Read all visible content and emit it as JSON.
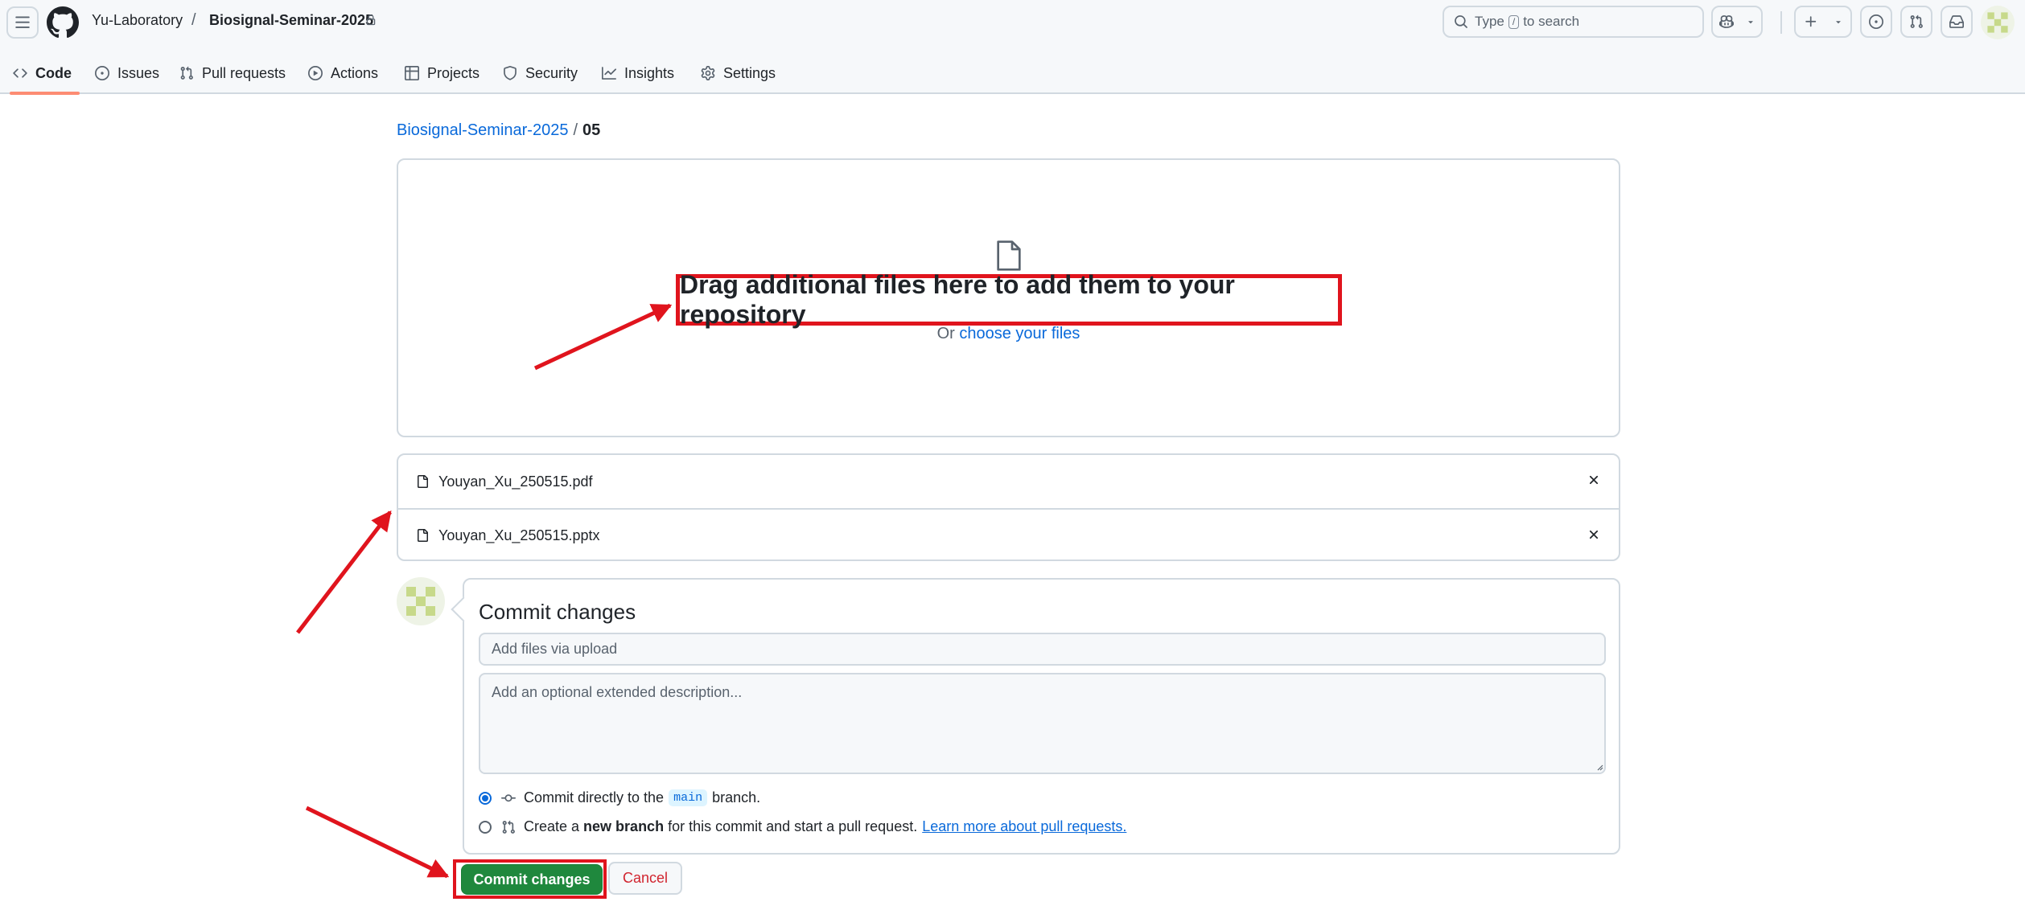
{
  "header": {
    "owner": "Yu-Laboratory",
    "separator": "/",
    "repo": "Biosignal-Seminar-2025",
    "search": {
      "prefix": "Type",
      "key": "/",
      "suffix": "to search"
    }
  },
  "tabs": [
    {
      "label": "Code",
      "icon": "code-icon",
      "active": true
    },
    {
      "label": "Issues",
      "icon": "issue-opened-icon"
    },
    {
      "label": "Pull requests",
      "icon": "git-pull-request-icon"
    },
    {
      "label": "Actions",
      "icon": "play-icon"
    },
    {
      "label": "Projects",
      "icon": "table-icon"
    },
    {
      "label": "Security",
      "icon": "shield-icon"
    },
    {
      "label": "Insights",
      "icon": "graph-icon"
    },
    {
      "label": "Settings",
      "icon": "gear-icon"
    }
  ],
  "breadcrumb": {
    "repo": "Biosignal-Seminar-2025",
    "separator": "/",
    "folder": "05"
  },
  "dropzone": {
    "title": "Drag additional files here to add them to your repository",
    "or": "Or",
    "choose": "choose your files"
  },
  "files": [
    {
      "name": "Youyan_Xu_250515.pdf"
    },
    {
      "name": "Youyan_Xu_250515.pptx"
    }
  ],
  "commit": {
    "title": "Commit changes",
    "message_placeholder": "Add files via upload",
    "description_placeholder": "Add an optional extended description...",
    "option_direct": {
      "before": "Commit directly to the",
      "branch": "main",
      "after": "branch.",
      "selected": true
    },
    "option_new": {
      "before": "Create a",
      "bold": "new branch",
      "after": "for this commit and start a pull request.",
      "link": "Learn more about pull requests."
    }
  },
  "buttons": {
    "commit": "Commit changes",
    "cancel": "Cancel"
  },
  "colors": {
    "accent": "#0969da",
    "primary_button": "#1f883d",
    "danger": "#d1242f",
    "annotation": "#e0141d",
    "tab_underline": "#fd8c73"
  }
}
